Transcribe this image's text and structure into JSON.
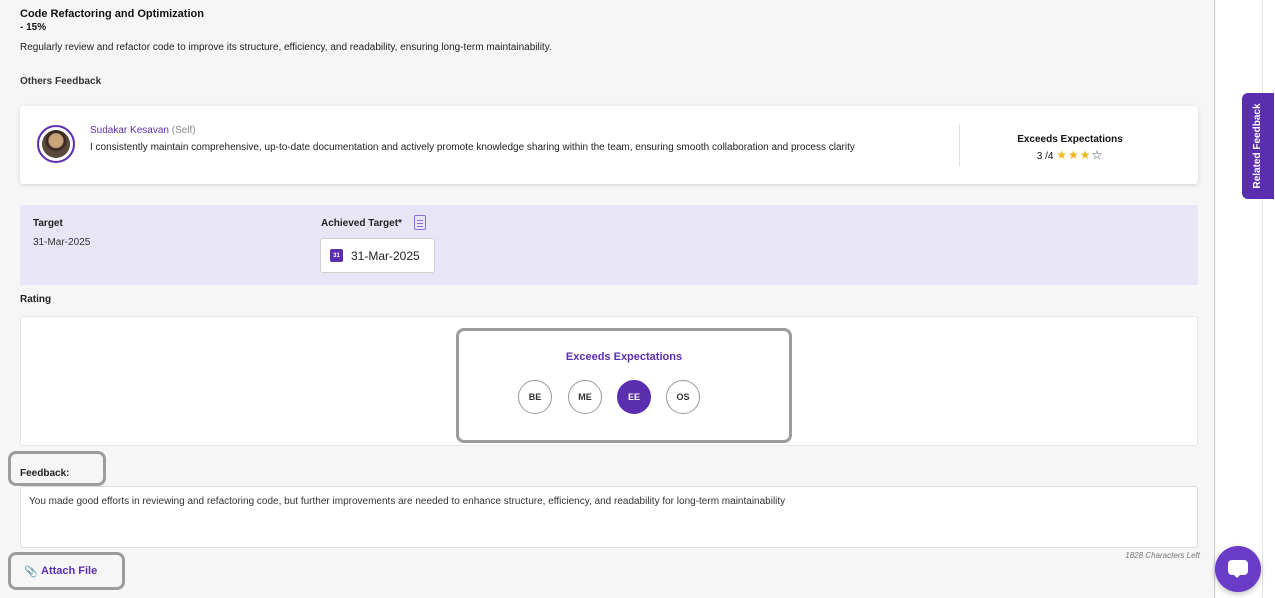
{
  "goal": {
    "title": "Code Refactoring and Optimization",
    "weight": "- 15%",
    "description": "Regularly review and refactor code to improve its structure, efficiency, and readability, ensuring long-term maintainability."
  },
  "others_feedback": {
    "label": "Others Feedback",
    "items": [
      {
        "name": "Sudakar Kesavan",
        "role": "(Self)",
        "text": "I consistently maintain comprehensive, up-to-date documentation and actively promote knowledge sharing within the team, ensuring smooth collaboration and process clarity",
        "rating_title": "Exceeds Expectations",
        "rating_score": "3 /4",
        "stars_filled": 3,
        "stars_total": 4
      }
    ]
  },
  "target": {
    "label": "Target",
    "value": "31-Mar-2025",
    "achieved_label": "Achieved Target*",
    "achieved_value": "31-Mar-2025"
  },
  "rating": {
    "label": "Rating",
    "selected_text": "Exceeds Expectations",
    "options": [
      "BE",
      "ME",
      "EE",
      "OS"
    ],
    "selected": "EE"
  },
  "feedback": {
    "label": "Feedback:",
    "value": "You made good efforts in reviewing and refactoring code, but further improvements are needed to enhance structure, efficiency, and readability for long-term maintainability",
    "chars_left": "1828 Characters Left"
  },
  "attach": {
    "label": "Attach File",
    "icon": "paperclip-icon"
  },
  "side": {
    "related_feedback": "Related Feedback",
    "chat_icon": "chat-icon"
  },
  "colors": {
    "accent": "#5b2eb0",
    "panel": "#e8e6f6",
    "star": "#f0b820"
  }
}
